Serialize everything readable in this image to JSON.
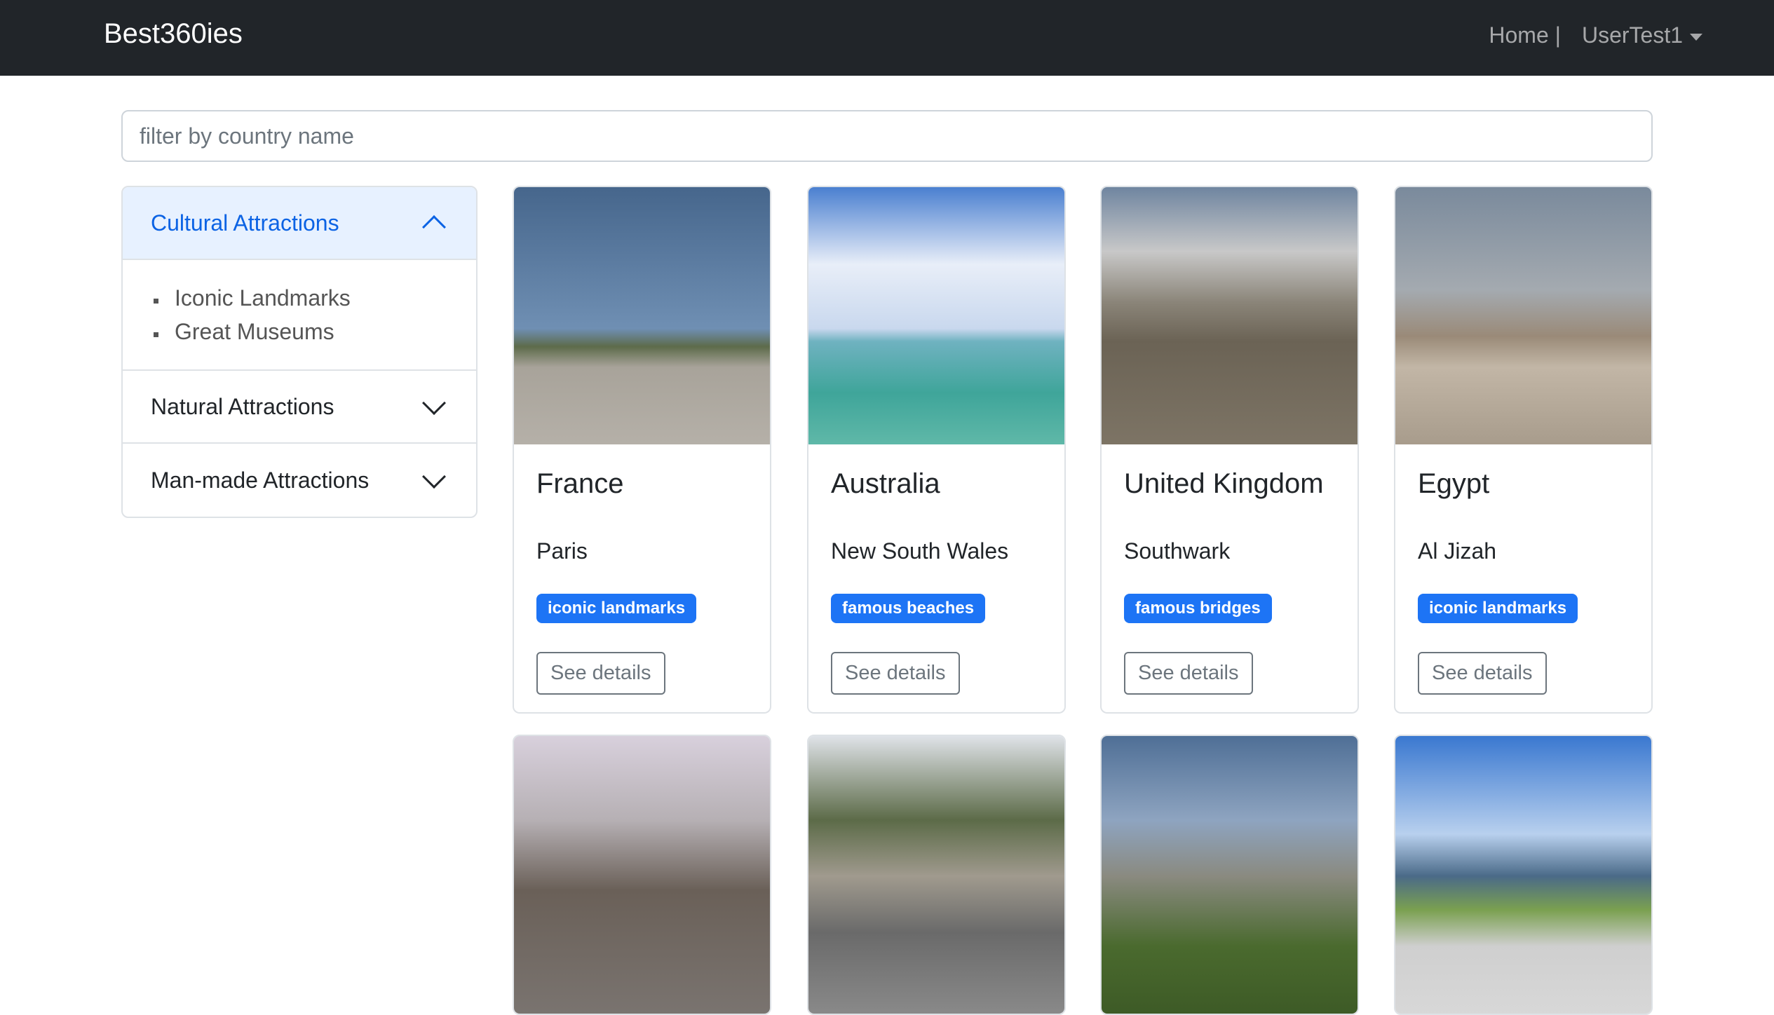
{
  "navbar": {
    "brand": "Best360ies",
    "home": "Home |",
    "user": "UserTest1"
  },
  "search": {
    "placeholder": "filter by country name",
    "value": ""
  },
  "sidebar": {
    "sections": [
      {
        "label": "Cultural Attractions",
        "expanded": true,
        "items": [
          "Iconic Landmarks",
          "Great Museums"
        ]
      },
      {
        "label": "Natural Attractions",
        "expanded": false
      },
      {
        "label": "Man-made Attractions",
        "expanded": false
      }
    ]
  },
  "cards": [
    {
      "country": "France",
      "region": "Paris",
      "tag": "iconic landmarks",
      "button": "See details"
    },
    {
      "country": "Australia",
      "region": "New South Wales",
      "tag": "famous beaches",
      "button": "See details"
    },
    {
      "country": "United Kingdom",
      "region": "Southwark",
      "tag": "famous bridges",
      "button": "See details"
    },
    {
      "country": "Egypt",
      "region": "Al Jizah",
      "tag": "iconic landmarks",
      "button": "See details"
    }
  ],
  "colors": {
    "navbar": "#212529",
    "accent": "#0c63e4",
    "badge": "#1d74f5"
  }
}
